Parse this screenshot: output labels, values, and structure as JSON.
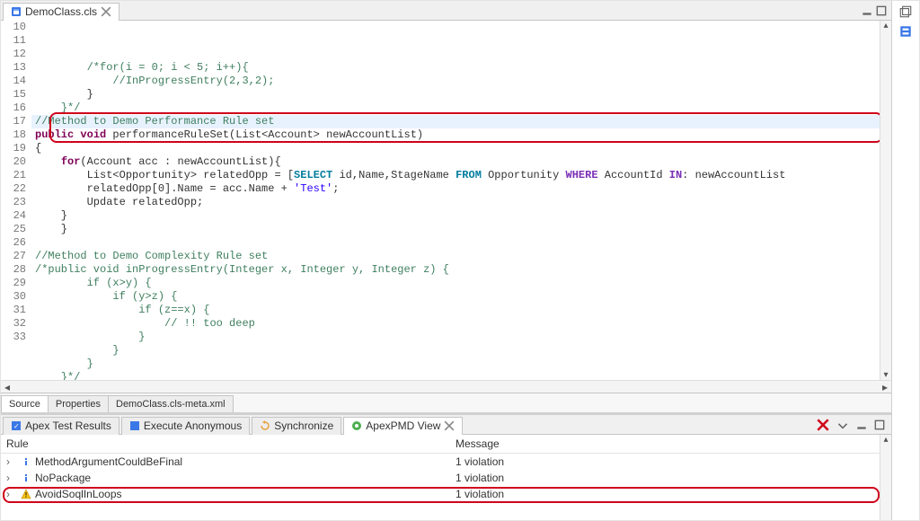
{
  "editor": {
    "tab_label": "DemoClass.cls",
    "lines": [
      {
        "n": 10,
        "ind": 2,
        "segs": [
          {
            "t": "/*for(i = 0; i < 5; i++){",
            "c": "tok-cm"
          }
        ]
      },
      {
        "n": 11,
        "ind": 3,
        "segs": [
          {
            "t": "//InProgressEntry(2,3,2);",
            "c": "tok-cm"
          }
        ]
      },
      {
        "n": 12,
        "ind": 2,
        "segs": [
          {
            "t": "}",
            "c": ""
          }
        ]
      },
      {
        "n": 13,
        "ind": 1,
        "segs": [
          {
            "t": "}*/",
            "c": "tok-cm"
          }
        ]
      },
      {
        "n": 14,
        "ind": 0,
        "hl": true,
        "segs": [
          {
            "t": "//Method to Demo Performance Rule set",
            "c": "tok-cm"
          }
        ]
      },
      {
        "n": 15,
        "ind": 0,
        "warn": true,
        "segs": [
          {
            "t": "public",
            "c": "tok-kw"
          },
          {
            "t": " void",
            "c": "tok-kw"
          },
          {
            "t": " performanceRuleSet(List<Account> newAccountList)",
            "c": ""
          }
        ]
      },
      {
        "n": 16,
        "ind": 0,
        "segs": [
          {
            "t": "{",
            "c": ""
          }
        ]
      },
      {
        "n": 17,
        "ind": 1,
        "segs": [
          {
            "t": "for",
            "c": "tok-kw"
          },
          {
            "t": "(Account acc : newAccountList){",
            "c": ""
          }
        ]
      },
      {
        "n": 18,
        "ind": 2,
        "warn": true,
        "segs": [
          {
            "t": "List<Opportunity> relatedOpp = [",
            "c": ""
          },
          {
            "t": "SELECT",
            "c": "tok-sql"
          },
          {
            "t": " id,Name,StageName ",
            "c": ""
          },
          {
            "t": "FROM",
            "c": "tok-sql"
          },
          {
            "t": " Opportunity ",
            "c": ""
          },
          {
            "t": "WHERE",
            "c": "tok-sqlkw"
          },
          {
            "t": " AccountId ",
            "c": ""
          },
          {
            "t": "IN",
            "c": "tok-sqlkw"
          },
          {
            "t": ": newAccountList",
            "c": ""
          }
        ]
      },
      {
        "n": 19,
        "ind": 2,
        "segs": [
          {
            "t": "relatedOpp[0].Name = acc.Name + ",
            "c": ""
          },
          {
            "t": "'Test'",
            "c": "tok-str"
          },
          {
            "t": ";",
            "c": ""
          }
        ]
      },
      {
        "n": 20,
        "ind": 2,
        "segs": [
          {
            "t": "Update",
            "c": ""
          },
          {
            "t": " relatedOpp;",
            "c": ""
          }
        ]
      },
      {
        "n": 21,
        "ind": 1,
        "segs": [
          {
            "t": "}",
            "c": ""
          }
        ]
      },
      {
        "n": 22,
        "ind": 1,
        "segs": [
          {
            "t": "}",
            "c": ""
          }
        ]
      },
      {
        "n": 23,
        "ind": 0,
        "segs": [
          {
            "t": "",
            "c": ""
          }
        ]
      },
      {
        "n": 24,
        "ind": 0,
        "segs": [
          {
            "t": "//Method to Demo Complexity Rule set",
            "c": "tok-cm"
          }
        ]
      },
      {
        "n": 25,
        "ind": 0,
        "warn": true,
        "segs": [
          {
            "t": "/*public void inProgressEntry(Integer x, Integer y, Integer z) {",
            "c": "tok-cm"
          }
        ]
      },
      {
        "n": 26,
        "ind": 2,
        "segs": [
          {
            "t": "if (x>y) {",
            "c": "tok-cm"
          }
        ]
      },
      {
        "n": 27,
        "ind": 3,
        "segs": [
          {
            "t": "if (y>z) {",
            "c": "tok-cm"
          }
        ]
      },
      {
        "n": 28,
        "ind": 4,
        "segs": [
          {
            "t": "if (z==x) {",
            "c": "tok-cm"
          }
        ]
      },
      {
        "n": 29,
        "ind": 5,
        "segs": [
          {
            "t": "// !! too deep",
            "c": "tok-cm"
          }
        ]
      },
      {
        "n": 30,
        "ind": 4,
        "segs": [
          {
            "t": "}",
            "c": "tok-cm"
          }
        ]
      },
      {
        "n": 31,
        "ind": 3,
        "segs": [
          {
            "t": "}",
            "c": "tok-cm"
          }
        ]
      },
      {
        "n": 32,
        "ind": 2,
        "segs": [
          {
            "t": "}",
            "c": "tok-cm"
          }
        ]
      },
      {
        "n": 33,
        "ind": 1,
        "segs": [
          {
            "t": "}*/",
            "c": "tok-cm"
          }
        ]
      }
    ]
  },
  "bottomTabs": {
    "source": "Source",
    "properties": "Properties",
    "meta": "DemoClass.cls-meta.xml"
  },
  "panel": {
    "tabs": {
      "apex_test": "Apex Test Results",
      "execute_anon": "Execute Anonymous",
      "synchronize": "Synchronize",
      "apex_pmd": "ApexPMD View"
    },
    "columns": {
      "rule": "Rule",
      "message": "Message"
    },
    "rows": [
      {
        "icon": "info",
        "rule": "MethodArgumentCouldBeFinal",
        "msg": "1 violation"
      },
      {
        "icon": "info",
        "rule": "NoPackage",
        "msg": "1 violation"
      },
      {
        "icon": "warn",
        "rule": "AvoidSoqlInLoops",
        "msg": "1 violation",
        "highlight": true
      }
    ]
  }
}
